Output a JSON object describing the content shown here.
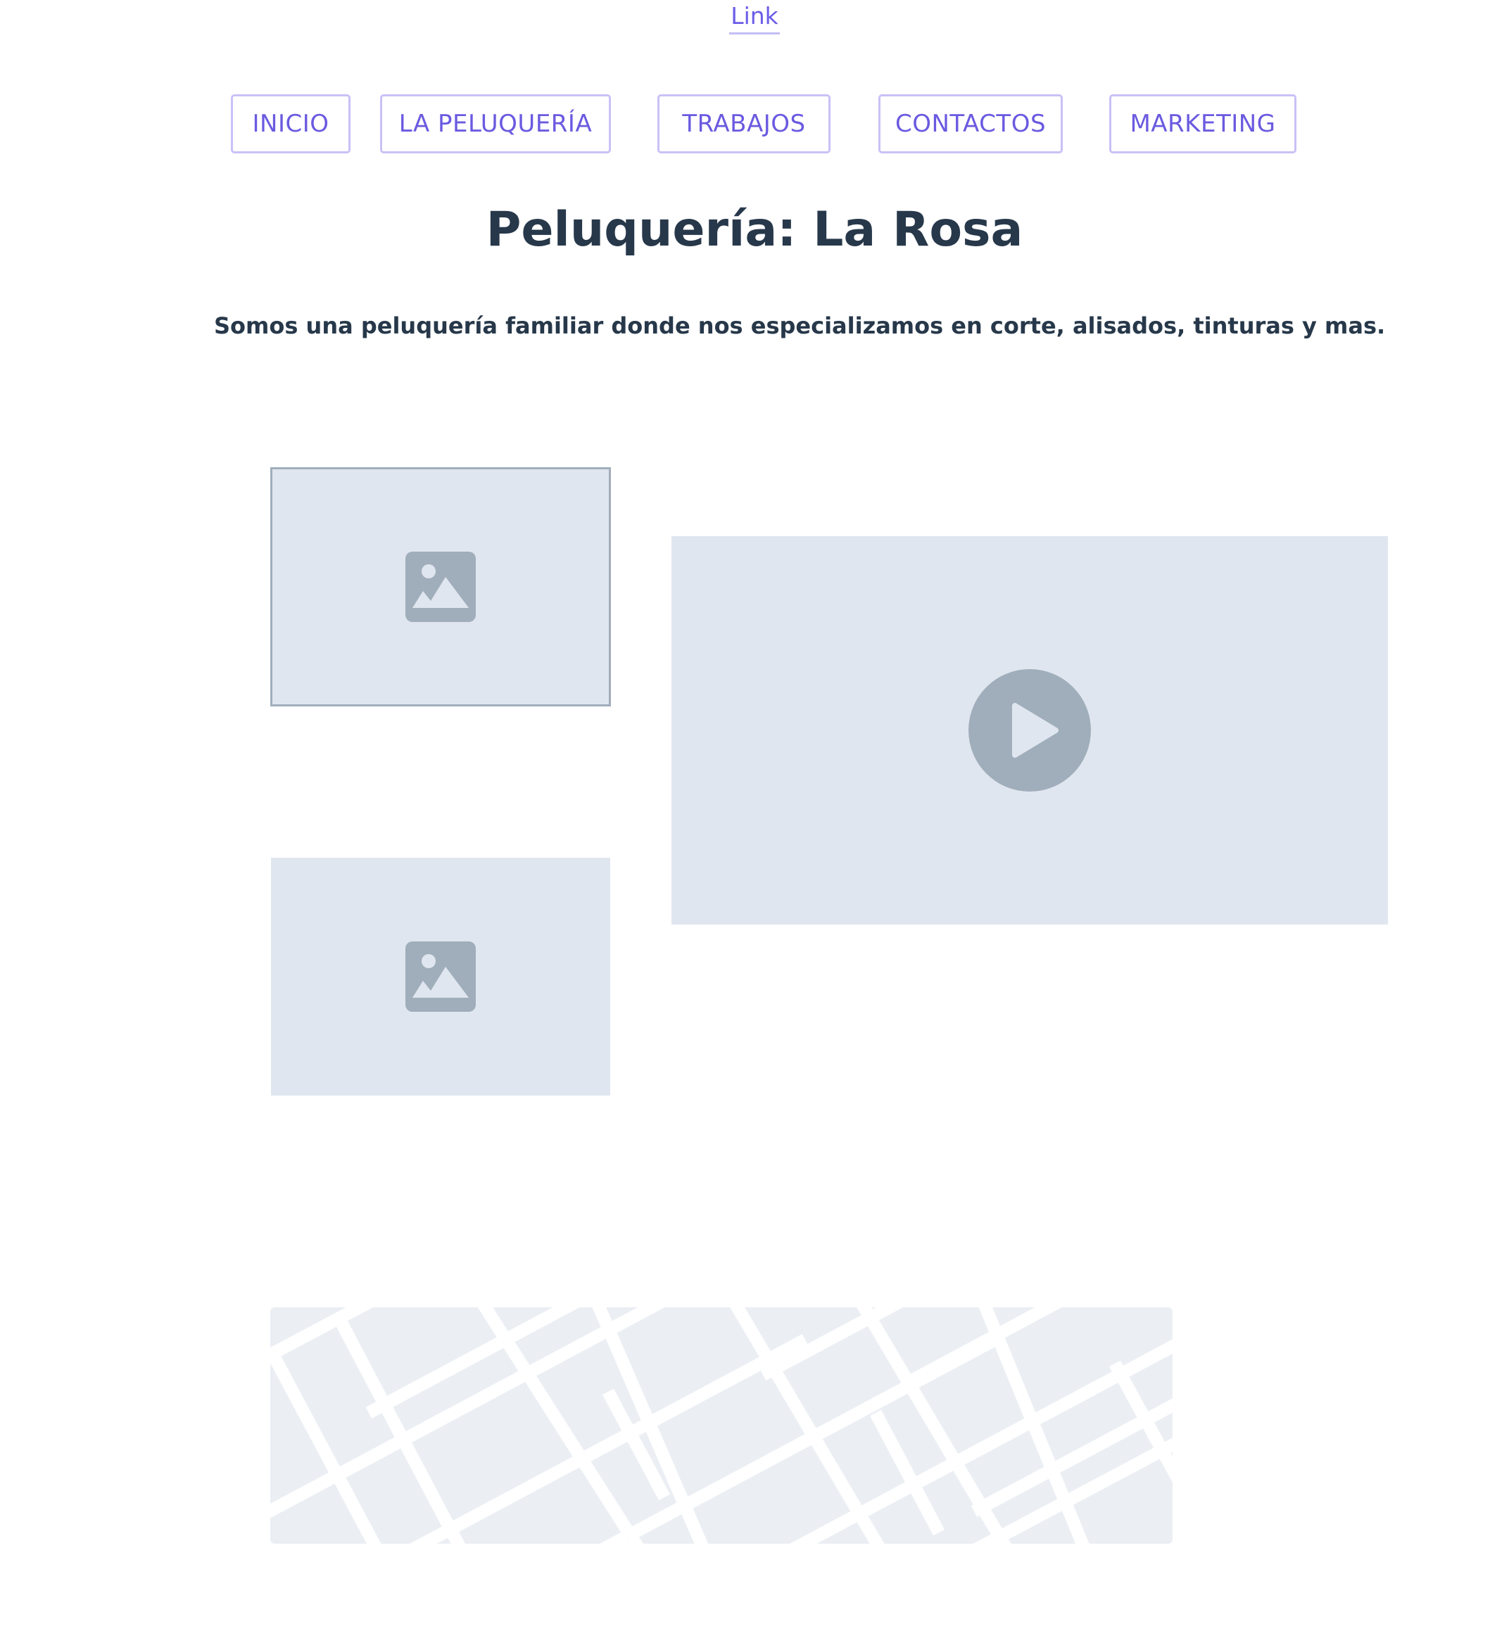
{
  "top_link": {
    "label": "Link"
  },
  "nav": {
    "items": [
      {
        "label": "INICIO"
      },
      {
        "label": "LA PELUQUERÍA"
      },
      {
        "label": "TRABAJOS"
      },
      {
        "label": "CONTACTOS"
      },
      {
        "label": "MARKETING"
      }
    ]
  },
  "header": {
    "title": "Peluquería: La Rosa"
  },
  "intro": {
    "text": "Somos una peluquería familiar donde nos especializamos en corte, alisados, tinturas y mas."
  },
  "media": {
    "image_icon": "image-icon",
    "video_icon": "play-icon",
    "map_icon": "map-placeholder"
  },
  "colors": {
    "accent": "#6a5ae0",
    "accent_border": "#c9c1f6",
    "text": "#27384a",
    "placeholder_bg": "#e0e6ef",
    "placeholder_icon": "#a0aebb",
    "map_bg": "#ebeff4"
  }
}
